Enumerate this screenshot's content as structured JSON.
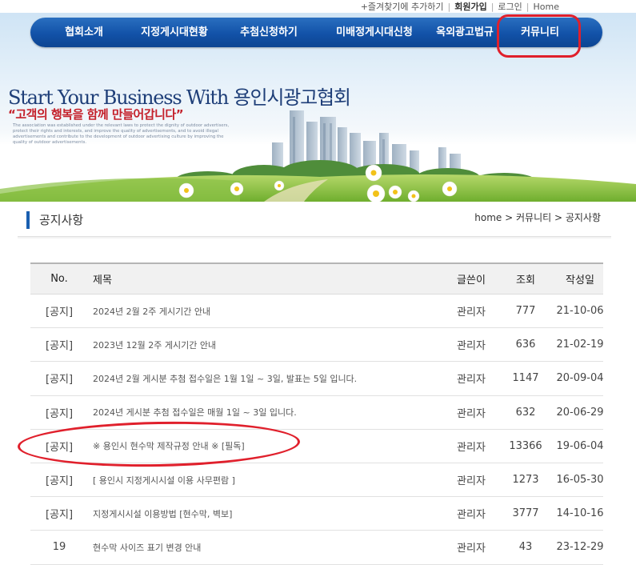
{
  "top_links": {
    "bookmark": "+즐겨찾기에 추가하기",
    "signup": "회원가입",
    "login": "로그인",
    "home": "Home"
  },
  "nav": {
    "items": [
      "협회소개",
      "지정게시대현황",
      "추첨신청하기",
      "미배정게시대신청",
      "옥외광고법규",
      "커뮤니티"
    ],
    "highlighted": "커뮤니티"
  },
  "banner": {
    "slogan": "Start Your Business With 용인시광고협회",
    "subtitle": "“고객의 행복을 함께 만들어갑니다”",
    "description": "The association was established under the relevant laws to protect the dignity of outdoor advertisers, protect their rights and interests, and improve the quality of advertisements, and to avoid illegal advertisements and contribute to the development of outdoor advertising culture by improving the quality of outdoor advertisements."
  },
  "page": {
    "title": "공지사항",
    "breadcrumb": "home > 커뮤니티 > 공지사항"
  },
  "table": {
    "headers": {
      "no": "No.",
      "title": "제목",
      "writer": "글쓴이",
      "views": "조회",
      "date": "작성일"
    },
    "rows": [
      {
        "no": "[공지]",
        "title": "2024년 2월 2주 게시기간 안내",
        "writer": "관리자",
        "views": "777",
        "date": "21-10-06"
      },
      {
        "no": "[공지]",
        "title": "2023년 12월 2주 게시기간 안내",
        "writer": "관리자",
        "views": "636",
        "date": "21-02-19"
      },
      {
        "no": "[공지]",
        "title": "2024년 2월 게시분 추첨 접수일은 1월 1일 ~ 3일, 발표는 5일 입니다.",
        "writer": "관리자",
        "views": "1147",
        "date": "20-09-04"
      },
      {
        "no": "[공지]",
        "title": "2024년 게시분 추첨 접수일은 매월 1일 ~ 3일 입니다.",
        "writer": "관리자",
        "views": "632",
        "date": "20-06-29"
      },
      {
        "no": "[공지]",
        "title": "※ 용인시 현수막 제작규정 안내 ※ [필독]",
        "writer": "관리자",
        "views": "13366",
        "date": "19-06-04"
      },
      {
        "no": "[공지]",
        "title": "[ 용인시 지정게시시설 이용 사무편람 ]",
        "writer": "관리자",
        "views": "1273",
        "date": "16-05-30"
      },
      {
        "no": "[공지]",
        "title": "지정게시시설 이용방법 [현수막, 벽보]",
        "writer": "관리자",
        "views": "3777",
        "date": "14-10-16"
      },
      {
        "no": "19",
        "title": "현수막 사이즈 표기 변경 안내",
        "writer": "관리자",
        "views": "43",
        "date": "23-12-29"
      }
    ]
  },
  "colors": {
    "nav_blue": "#1252a8",
    "highlight_red": "#e0202c",
    "title_bar_blue": "#1a5fb0"
  }
}
